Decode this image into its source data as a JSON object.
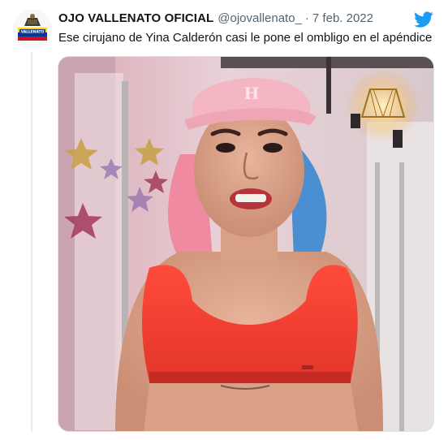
{
  "tweet": {
    "display_name": "OJO VALLENATO OFICIAL",
    "handle": "@ojovallenato_",
    "separator": "·",
    "date": "7 feb. 2022",
    "text": "Ese cirujano de Yina Calderón casi le pone el ombligo en el apéndice",
    "avatar_logo_text": "VALLENATO",
    "avatar_icon": "ojo-vallenato-logo",
    "platform_icon": "twitter-bird-icon"
  },
  "colors": {
    "brand_blue": "#1d9bf0",
    "secondary_text": "#536471",
    "primary_text": "#0f1419",
    "top_red": "#e93b2f",
    "cap_pink": "#f3b6c2"
  },
  "media": {
    "type": "photo"
  }
}
